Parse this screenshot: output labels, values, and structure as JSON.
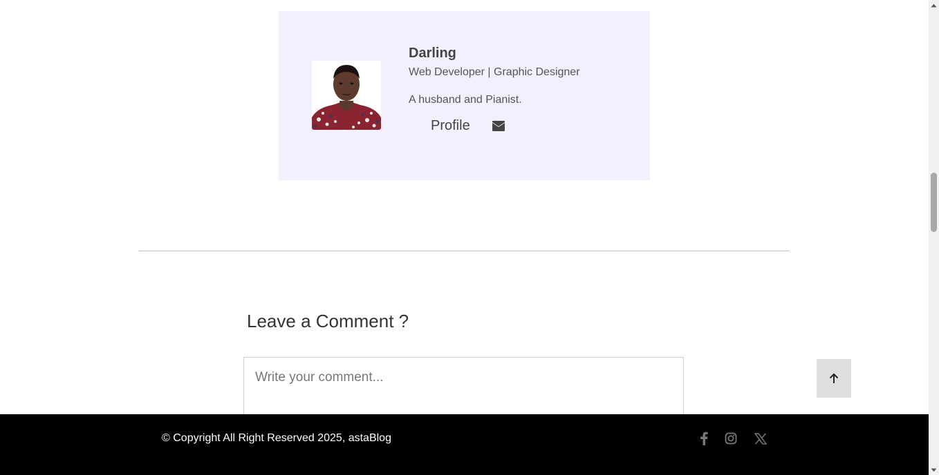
{
  "author": {
    "name": "Darling",
    "role": "Web Developer | Graphic Designer",
    "bio": "A husband and Pianist.",
    "profile_label": "Profile",
    "mail_icon": "envelope-icon"
  },
  "comments": {
    "title": "Leave a Comment ?",
    "placeholder": "Write your comment..."
  },
  "back_to_top_icon": "arrow-up-icon",
  "footer": {
    "copyright": "© Copyright All Right Reserved 2025, astaBlog",
    "social": [
      "facebook-icon",
      "instagram-icon",
      "x-icon"
    ]
  },
  "colors": {
    "card_bg": "#f2f0fd",
    "footer_bg": "#000000",
    "back_top_bg": "#dedede"
  }
}
